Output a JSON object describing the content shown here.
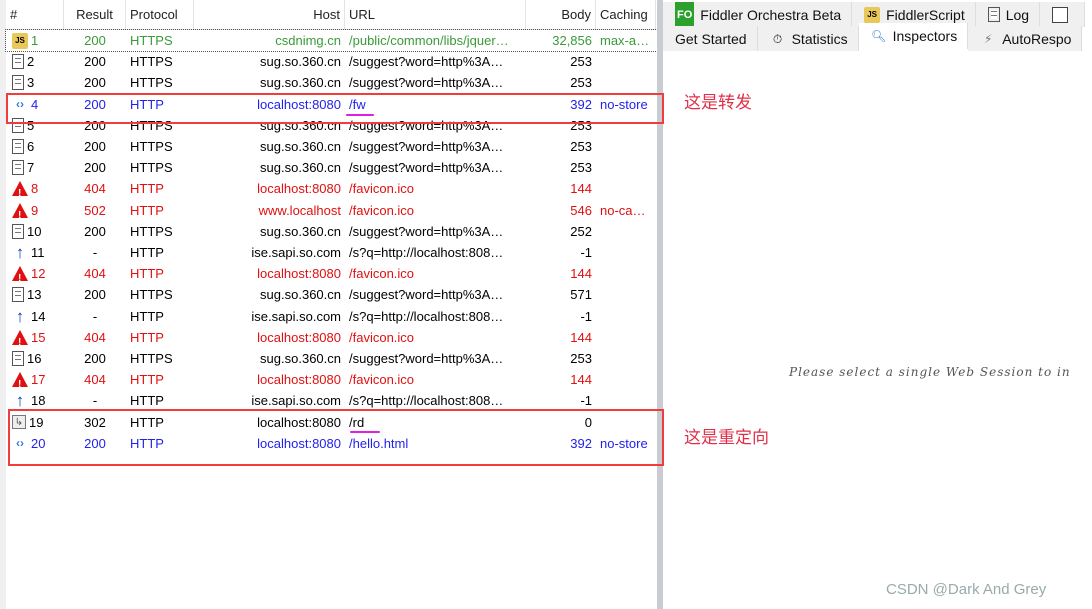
{
  "columns": [
    "#",
    "Result",
    "Protocol",
    "Host",
    "URL",
    "Body",
    "Caching"
  ],
  "rows": [
    {
      "id": "1",
      "result": "200",
      "protocol": "HTTPS",
      "host": "csdnimg.cn",
      "url": "/public/common/libs/jquer…",
      "body": "32,856",
      "caching": "max-ag…",
      "icon": "js-icon",
      "color": "#3a9a3a"
    },
    {
      "id": "2",
      "result": "200",
      "protocol": "HTTPS",
      "host": "sug.so.360.cn",
      "url": "/suggest?word=http%3A…",
      "body": "253",
      "caching": "",
      "icon": "document-icon",
      "color": "#000000"
    },
    {
      "id": "3",
      "result": "200",
      "protocol": "HTTPS",
      "host": "sug.so.360.cn",
      "url": "/suggest?word=http%3A…",
      "body": "253",
      "caching": "",
      "icon": "document-icon",
      "color": "#000000"
    },
    {
      "id": "4",
      "result": "200",
      "protocol": "HTTP",
      "host": "localhost:8080",
      "url": "/fw",
      "body": "392",
      "caching": "no-store",
      "icon": "html-arrows-icon",
      "color": "#2222ee"
    },
    {
      "id": "5",
      "result": "200",
      "protocol": "HTTPS",
      "host": "sug.so.360.cn",
      "url": "/suggest?word=http%3A…",
      "body": "253",
      "caching": "",
      "icon": "document-icon",
      "color": "#000000"
    },
    {
      "id": "6",
      "result": "200",
      "protocol": "HTTPS",
      "host": "sug.so.360.cn",
      "url": "/suggest?word=http%3A…",
      "body": "253",
      "caching": "",
      "icon": "document-icon",
      "color": "#000000"
    },
    {
      "id": "7",
      "result": "200",
      "protocol": "HTTPS",
      "host": "sug.so.360.cn",
      "url": "/suggest?word=http%3A…",
      "body": "253",
      "caching": "",
      "icon": "document-icon",
      "color": "#000000"
    },
    {
      "id": "8",
      "result": "404",
      "protocol": "HTTP",
      "host": "localhost:8080",
      "url": "/favicon.ico",
      "body": "144",
      "caching": "",
      "icon": "warning-icon",
      "color": "#e01010"
    },
    {
      "id": "9",
      "result": "502",
      "protocol": "HTTP",
      "host": "www.localhost",
      "url": "/favicon.ico",
      "body": "546",
      "caching": "no-cac…",
      "icon": "warning-icon",
      "color": "#e01010"
    },
    {
      "id": "10",
      "result": "200",
      "protocol": "HTTPS",
      "host": "sug.so.360.cn",
      "url": "/suggest?word=http%3A…",
      "body": "252",
      "caching": "",
      "icon": "document-icon",
      "color": "#000000"
    },
    {
      "id": "11",
      "result": "-",
      "protocol": "HTTP",
      "host": "ise.sapi.so.com",
      "url": "/s?q=http://localhost:808…",
      "body": "-1",
      "caching": "",
      "icon": "upload-arrow-icon",
      "color": "#000000"
    },
    {
      "id": "12",
      "result": "404",
      "protocol": "HTTP",
      "host": "localhost:8080",
      "url": "/favicon.ico",
      "body": "144",
      "caching": "",
      "icon": "warning-icon",
      "color": "#e01010"
    },
    {
      "id": "13",
      "result": "200",
      "protocol": "HTTPS",
      "host": "sug.so.360.cn",
      "url": "/suggest?word=http%3A…",
      "body": "571",
      "caching": "",
      "icon": "document-icon",
      "color": "#000000"
    },
    {
      "id": "14",
      "result": "-",
      "protocol": "HTTP",
      "host": "ise.sapi.so.com",
      "url": "/s?q=http://localhost:808…",
      "body": "-1",
      "caching": "",
      "icon": "upload-arrow-icon",
      "color": "#000000"
    },
    {
      "id": "15",
      "result": "404",
      "protocol": "HTTP",
      "host": "localhost:8080",
      "url": "/favicon.ico",
      "body": "144",
      "caching": "",
      "icon": "warning-icon",
      "color": "#e01010"
    },
    {
      "id": "16",
      "result": "200",
      "protocol": "HTTPS",
      "host": "sug.so.360.cn",
      "url": "/suggest?word=http%3A…",
      "body": "253",
      "caching": "",
      "icon": "document-icon",
      "color": "#000000"
    },
    {
      "id": "17",
      "result": "404",
      "protocol": "HTTP",
      "host": "localhost:8080",
      "url": "/favicon.ico",
      "body": "144",
      "caching": "",
      "icon": "warning-icon",
      "color": "#e01010"
    },
    {
      "id": "18",
      "result": "-",
      "protocol": "HTTP",
      "host": "ise.sapi.so.com",
      "url": "/s?q=http://localhost:808…",
      "body": "-1",
      "caching": "",
      "icon": "upload-arrow-icon",
      "color": "#000000"
    },
    {
      "id": "19",
      "result": "302",
      "protocol": "HTTP",
      "host": "localhost:8080",
      "url": "/rd",
      "body": "0",
      "caching": "",
      "icon": "redirect-icon",
      "color": "#000000"
    },
    {
      "id": "20",
      "result": "200",
      "protocol": "HTTP",
      "host": "localhost:8080",
      "url": "/hello.html",
      "body": "392",
      "caching": "no-store",
      "icon": "html-arrows-icon",
      "color": "#2222ee"
    }
  ],
  "tabs_top": [
    {
      "label": "Fiddler Orchestra Beta",
      "icon": "fo-icon"
    },
    {
      "label": "FiddlerScript",
      "icon": "js-icon"
    },
    {
      "label": "Log",
      "icon": "log-icon"
    },
    {
      "label": "",
      "icon": "window-icon"
    }
  ],
  "tabs_bottom": [
    {
      "label": "Get Started"
    },
    {
      "label": "Statistics",
      "icon": "stopwatch-icon"
    },
    {
      "label": "Inspectors",
      "icon": "magnifier-icon",
      "active": true
    },
    {
      "label": "AutoRespo",
      "icon": "lightning-icon"
    }
  ],
  "fo_badge": "FO",
  "inspector_message": "Please select a single Web Session to in",
  "annotations": {
    "forward": "这是转发",
    "redirect": "这是重定向"
  },
  "watermark": "CSDN @Dark And Grey"
}
